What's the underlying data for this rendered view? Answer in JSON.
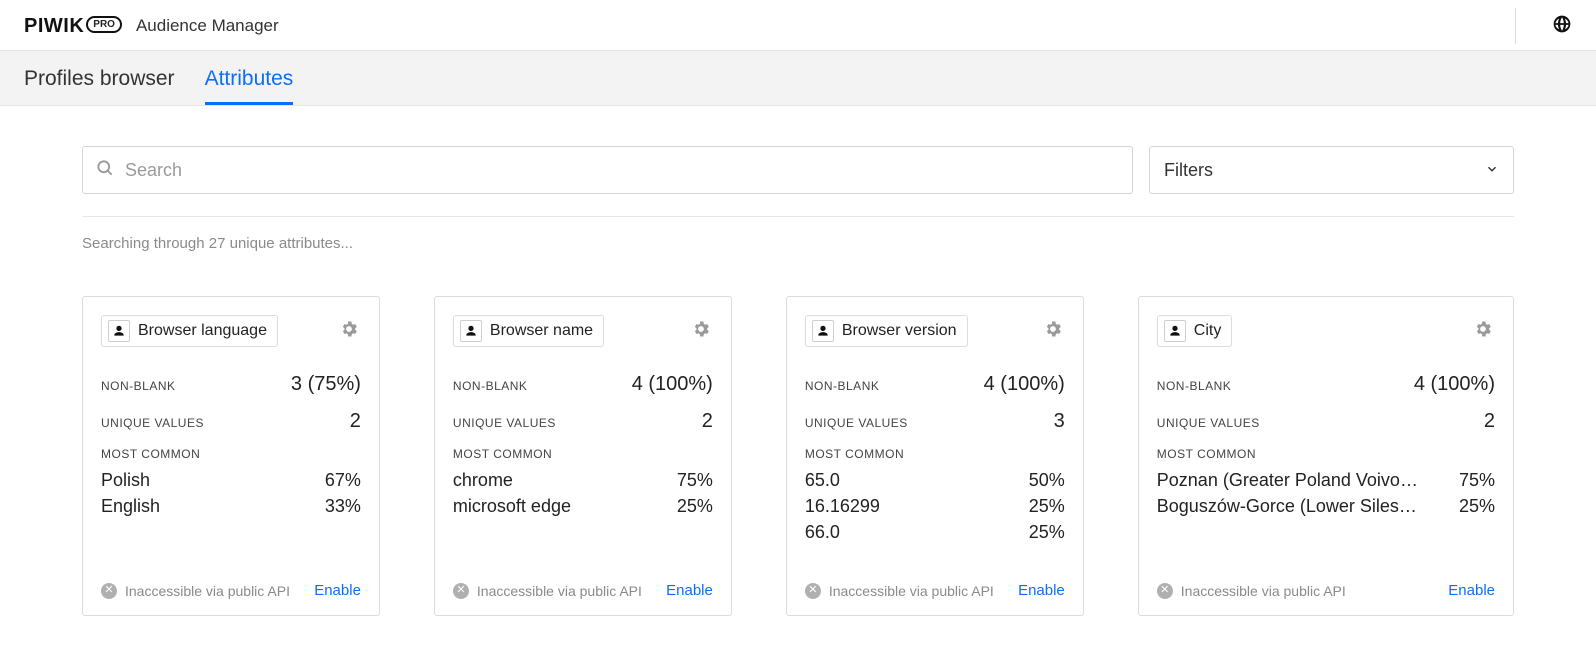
{
  "brand": {
    "name": "PIWIK",
    "badge": "PRO",
    "app": "Audience Manager"
  },
  "tabs": [
    {
      "label": "Profiles browser",
      "active": false
    },
    {
      "label": "Attributes",
      "active": true
    }
  ],
  "search": {
    "placeholder": "Search"
  },
  "filters": {
    "label": "Filters"
  },
  "status": "Searching through 27 unique attributes...",
  "labels": {
    "non_blank": "NON-BLANK",
    "unique": "UNIQUE VALUES",
    "most_common": "MOST COMMON",
    "inaccessible": "Inaccessible via public API",
    "enable": "Enable"
  },
  "cards": [
    {
      "title": "Browser language",
      "non_blank": "3 (75%)",
      "unique": "2",
      "most_common": [
        {
          "label": "Polish",
          "pct": "67%"
        },
        {
          "label": "English",
          "pct": "33%"
        }
      ]
    },
    {
      "title": "Browser name",
      "non_blank": "4 (100%)",
      "unique": "2",
      "most_common": [
        {
          "label": "chrome",
          "pct": "75%"
        },
        {
          "label": "microsoft edge",
          "pct": "25%"
        }
      ]
    },
    {
      "title": "Browser version",
      "non_blank": "4 (100%)",
      "unique": "3",
      "most_common": [
        {
          "label": "65.0",
          "pct": "50%"
        },
        {
          "label": "16.16299",
          "pct": "25%"
        },
        {
          "label": "66.0",
          "pct": "25%"
        }
      ]
    },
    {
      "title": "City",
      "non_blank": "4 (100%)",
      "unique": "2",
      "most_common": [
        {
          "label": "Poznan (Greater Poland Voivodeship)",
          "pct": "75%"
        },
        {
          "label": "Boguszów-Gorce (Lower Silesian)",
          "pct": "25%"
        }
      ]
    }
  ]
}
